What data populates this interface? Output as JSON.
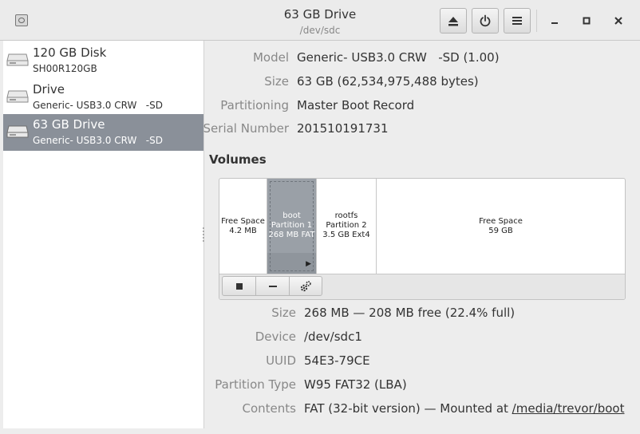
{
  "window": {
    "title": "63 GB Drive",
    "subtitle": "/dev/sdc"
  },
  "sidebar": {
    "drives": [
      {
        "name": "120 GB Disk",
        "detail": "SH00R120GB",
        "selected": false
      },
      {
        "name": "Drive",
        "detail": "Generic- USB3.0 CRW   -SD",
        "selected": false
      },
      {
        "name": "63 GB Drive",
        "detail": "Generic- USB3.0 CRW   -SD",
        "selected": true
      }
    ]
  },
  "drive_info": {
    "model_label": "Model",
    "model": "Generic- USB3.0 CRW   -SD (1.00)",
    "size_label": "Size",
    "size": "63 GB (62,534,975,488 bytes)",
    "partitioning_label": "Partitioning",
    "partitioning": "Master Boot Record",
    "serial_label": "Serial Number",
    "serial": "201510191731"
  },
  "volumes": {
    "heading": "Volumes",
    "segments": [
      {
        "lines": [
          "Free Space",
          "4.2 MB"
        ],
        "selected": false
      },
      {
        "lines": [
          "boot",
          "Partition 1",
          "268 MB FAT"
        ],
        "selected": true
      },
      {
        "lines": [
          "rootfs",
          "Partition 2",
          "3.5 GB Ext4"
        ],
        "selected": false
      },
      {
        "lines": [
          "Free Space",
          "59 GB"
        ],
        "selected": false
      }
    ]
  },
  "partition_info": {
    "size_label": "Size",
    "size": "268 MB — 208 MB free (22.4% full)",
    "device_label": "Device",
    "device": "/dev/sdc1",
    "uuid_label": "UUID",
    "uuid": "54E3-79CE",
    "type_label": "Partition Type",
    "type": "W95 FAT32 (LBA)",
    "contents_label": "Contents",
    "contents_prefix": "FAT (32-bit version) — Mounted at ",
    "mount_point": "/media/trevor/boot"
  },
  "icons": {
    "app": "disks-app-icon",
    "eject": "eject-icon",
    "power": "power-icon",
    "menu": "hamburger-menu-icon",
    "minimize": "minimize-icon",
    "maximize": "maximize-icon",
    "close": "close-icon",
    "drive": "drive-icon",
    "stop": "stop-icon",
    "minus": "minus-icon",
    "settings": "gears-icon",
    "play": "play-icon"
  }
}
